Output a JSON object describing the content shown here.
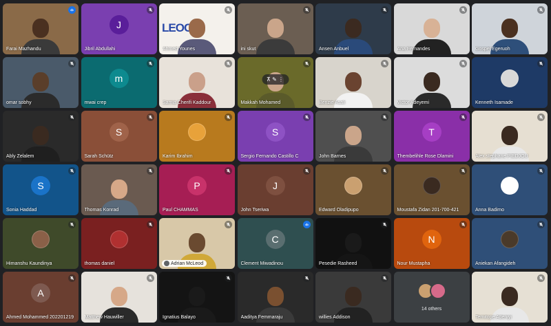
{
  "meeting": {
    "participants": [
      {
        "name": "Farai Mazhandu",
        "mode": "video",
        "bg": "#8a6a48",
        "skin": "#4a3020",
        "shirt": "#3a3a3a",
        "mic": "speaking"
      },
      {
        "name": "Jibril Abdullahi",
        "mode": "avatar",
        "initial": "J",
        "bg": "#7a3fb0",
        "circle": "#5a1e9a",
        "mic": "muted"
      },
      {
        "name": "Ahmed Younes",
        "mode": "logo",
        "bg": "#f4f1ec",
        "skin": "#9a6a4a",
        "shirt": "#5a5a7a",
        "mic": "muted",
        "logo_label": "LEOCG"
      },
      {
        "name": "ini skut",
        "mode": "video",
        "bg": "#6b5e52",
        "skin": "#caa58a",
        "shirt": "#3b3b3b",
        "mic": "muted"
      },
      {
        "name": "Ansen Anbuel",
        "mode": "video",
        "bg": "#2e3b4a",
        "skin": "#3b2a20",
        "shirt": "#2a4a7a",
        "mic": "muted"
      },
      {
        "name": "Ana Fernandes",
        "mode": "video",
        "bg": "#d9d9d9",
        "skin": "#d8b296",
        "shirt": "#222222",
        "mic": "muted"
      },
      {
        "name": "Gospel Egeruoh",
        "mode": "video",
        "bg": "#cfd4da",
        "skin": "#4a3020",
        "shirt": "#2e4f7a",
        "mic": "muted"
      },
      {
        "name": "omar sobhy",
        "mode": "video",
        "bg": "#4a5a6a",
        "skin": "#5a3e2a",
        "shirt": "#2b2b2b",
        "mic": "muted"
      },
      {
        "name": "mwai crep",
        "mode": "avatar",
        "initial": "m",
        "bg": "#0b6b70",
        "circle": "#0d8a8f",
        "mic": "muted"
      },
      {
        "name": "Samia Cherifi Kaddour",
        "mode": "video",
        "bg": "#e8e2da",
        "skin": "#caa08a",
        "shirt": "#8a2f3a",
        "mic": "muted"
      },
      {
        "name": "Makkah Mohamed",
        "mode": "pinned",
        "bg": "#6a6a2a",
        "skin": "#caa58a",
        "shirt": "#5a5a2a",
        "mic": "muted",
        "pin_icons": "⊼  ✎  ⋮"
      },
      {
        "name": "Benzie Asali",
        "mode": "video",
        "bg": "#d8d4cc",
        "skin": "#6a4330",
        "shirt": "#f2f2f2",
        "mic": "muted"
      },
      {
        "name": "Victor Adeyemi",
        "mode": "video",
        "bg": "#dcdcdc",
        "skin": "#3a2a20",
        "shirt": "#2a2a2a",
        "mic": "muted"
      },
      {
        "name": "Kenneth Isamade",
        "mode": "photo",
        "bg": "#1e3a66",
        "av": "#d8d8d8",
        "mic": "muted"
      },
      {
        "name": "Ably Zelalem",
        "mode": "video",
        "bg": "#2a2a2a",
        "skin": "#3a2a20",
        "shirt": "#1f1f1f",
        "mic": "muted"
      },
      {
        "name": "Sarah Schütz",
        "mode": "avatar",
        "initial": "S",
        "bg": "#8a4f38",
        "circle": "#a0634a",
        "mic": "muted"
      },
      {
        "name": "Karim Ibrahim",
        "mode": "photo",
        "bg": "#b87a1e",
        "av": "#e8a23a",
        "mic": "muted"
      },
      {
        "name": "Sergio Fernando Castillo C",
        "mode": "avatar",
        "initial": "S",
        "bg": "#7a3fb0",
        "circle": "#8e52c4",
        "mic": "muted"
      },
      {
        "name": "John Barnes",
        "mode": "video",
        "bg": "#4f4f4f",
        "skin": "#caa58a",
        "shirt": "#3a3a3a",
        "mic": "muted"
      },
      {
        "name": "Thembelihle Rose Dlamini",
        "mode": "avatar",
        "initial": "T",
        "bg": "#8a2fa8",
        "circle": "#a63ec4",
        "mic": "muted"
      },
      {
        "name": "Alex stephane PIEDJOU",
        "mode": "video",
        "bg": "#e6dfd2",
        "skin": "#3a2a20",
        "shirt": "#e8e8e8",
        "mic": "muted"
      },
      {
        "name": "Sonia Haddad",
        "mode": "avatar",
        "initial": "S",
        "bg": "#12548a",
        "circle": "#1a73c8",
        "mic": "muted"
      },
      {
        "name": "Thomas Konrad",
        "mode": "video",
        "bg": "#6a5a50",
        "skin": "#d6a888",
        "shirt": "#5a6a7a",
        "mic": "muted"
      },
      {
        "name": "Paul CHAMMAS",
        "mode": "avatar",
        "initial": "P",
        "bg": "#a61e54",
        "circle": "#c8326a",
        "mic": "muted"
      },
      {
        "name": "John Tseriwa",
        "mode": "avatar",
        "initial": "J",
        "bg": "#6a3e30",
        "circle": "#7e5040",
        "mic": "muted"
      },
      {
        "name": "Edward Oladipupo",
        "mode": "photo",
        "bg": "#6a5030",
        "av": "#caa070",
        "mic": "muted"
      },
      {
        "name": "Moustafa Zidan 201-700-421",
        "mode": "photo",
        "bg": "#6a5030",
        "av": "#3a2a20",
        "mic": "muted"
      },
      {
        "name": "Anna Badimo",
        "mode": "photo",
        "bg": "#2f4f78",
        "av": "#ffffff",
        "mic": "muted"
      },
      {
        "name": "Himanshu Kaundinya",
        "mode": "photo",
        "bg": "#3f4a2a",
        "av": "#8a6048",
        "mic": "muted"
      },
      {
        "name": "thomas daniel",
        "mode": "photo",
        "bg": "#7a2020",
        "av": "#b03030",
        "mic": "muted"
      },
      {
        "name": "Adrian McLeod",
        "mode": "speaker",
        "bg": "#d8c8a8",
        "skin": "#6a4a30",
        "shirt": "#d0a838",
        "mic": "muted"
      },
      {
        "name": "Clement Miwadinou",
        "mode": "avatar",
        "initial": "C",
        "bg": "#2f4f50",
        "circle": "#5a6e70",
        "mic": "speaking"
      },
      {
        "name": "Pesedie Rasheed",
        "mode": "video",
        "bg": "#111111",
        "skin": "#1a1a1a",
        "shirt": "#151515",
        "mic": "muted"
      },
      {
        "name": "Nour Mustapha",
        "mode": "avatar",
        "initial": "N",
        "bg": "#b84a0e",
        "circle": "#e0640e",
        "mic": "muted"
      },
      {
        "name": "Aniekan Afangideh",
        "mode": "photo",
        "bg": "#2f4f78",
        "av": "#4a3a2a",
        "mic": "muted"
      },
      {
        "name": "Ahmed Mohammed 202201219",
        "mode": "avatar",
        "initial": "A",
        "bg": "#6a3e30",
        "circle": "#7e5a50",
        "mic": "muted"
      },
      {
        "name": "Matthew Hauwiller",
        "mode": "video",
        "bg": "#e6e2dc",
        "skin": "#d6a888",
        "shirt": "#2a2a2a",
        "mic": "muted"
      },
      {
        "name": "Ignatius Balayo",
        "mode": "video",
        "bg": "#141414",
        "skin": "#1a1a1a",
        "shirt": "#1a1a1a",
        "mic": "muted"
      },
      {
        "name": "Aaditya Femmaraju",
        "mode": "video",
        "bg": "#2a2a2a",
        "skin": "#7a5030",
        "shirt": "#3a3a3a",
        "mic": "muted"
      },
      {
        "name": "willies Addison",
        "mode": "video",
        "bg": "#3a3a3a",
        "skin": "#3a2a20",
        "shirt": "#222222",
        "mic": "muted"
      },
      {
        "name": "",
        "mode": "others",
        "bg": "#3c4043",
        "others_label": "14 others",
        "o1": "#caa070",
        "o2": "#d66a8a"
      },
      {
        "name": "Temitope Adeniyi",
        "mode": "video",
        "bg": "#e6e0d4",
        "skin": "#3a2a20",
        "shirt": "#e8e8e8",
        "mic": "muted"
      }
    ]
  }
}
